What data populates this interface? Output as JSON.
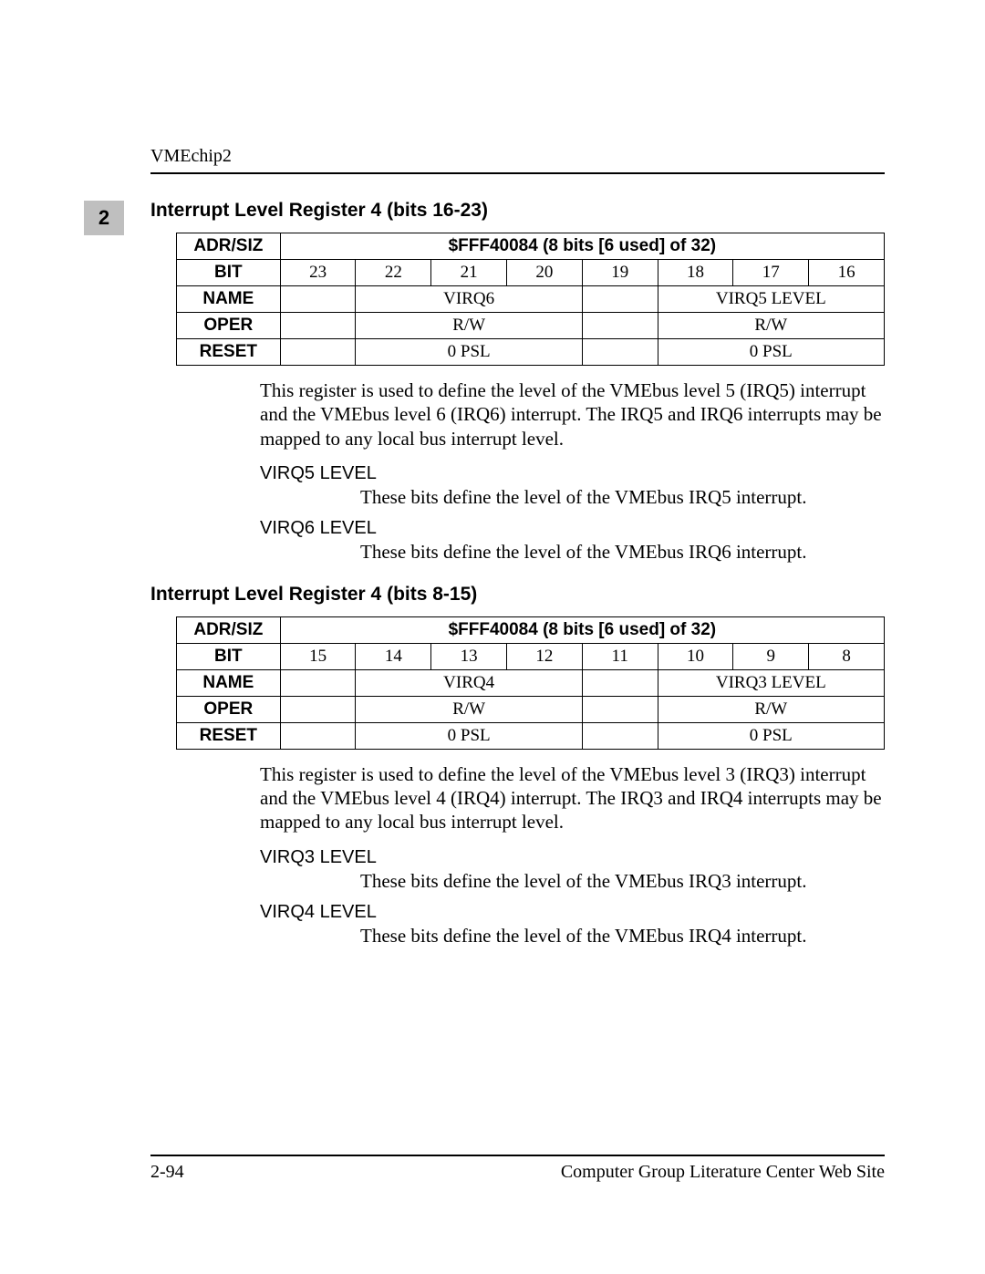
{
  "running_head": "VMEchip2",
  "chapter_tab": "2",
  "section1": {
    "title": "Interrupt Level Register 4 (bits 16-23)",
    "table": {
      "rowlabels": {
        "adrsiz": "ADR/SIZ",
        "bit": "BIT",
        "name": "NAME",
        "oper": "OPER",
        "reset": "RESET"
      },
      "adrsiz": "$FFF40084 (8 bits [6 used] of 32)",
      "bits": [
        "23",
        "22",
        "21",
        "20",
        "19",
        "18",
        "17",
        "16"
      ],
      "name_a": "VIRQ6",
      "name_b": "VIRQ5 LEVEL",
      "oper_a": "R/W",
      "oper_b": "R/W",
      "reset_a": "0 PSL",
      "reset_b": "0 PSL"
    },
    "paragraph": "This register is used to define the level of the VMEbus level 5 (IRQ5) interrupt and the VMEbus level 6 (IRQ6) interrupt. The IRQ5 and IRQ6 interrupts may be mapped to any local bus interrupt level.",
    "fields": [
      {
        "name": "VIRQ5 LEVEL",
        "desc": "These bits define the level of the VMEbus IRQ5 interrupt."
      },
      {
        "name": "VIRQ6 LEVEL",
        "desc": "These bits define the level of the VMEbus IRQ6 interrupt."
      }
    ]
  },
  "section2": {
    "title": "Interrupt Level Register 4 (bits 8-15)",
    "table": {
      "rowlabels": {
        "adrsiz": "ADR/SIZ",
        "bit": "BIT",
        "name": "NAME",
        "oper": "OPER",
        "reset": "RESET"
      },
      "adrsiz": "$FFF40084 (8 bits [6 used] of 32)",
      "bits": [
        "15",
        "14",
        "13",
        "12",
        "11",
        "10",
        "9",
        "8"
      ],
      "name_a": "VIRQ4",
      "name_b": "VIRQ3 LEVEL",
      "oper_a": "R/W",
      "oper_b": "R/W",
      "reset_a": "0 PSL",
      "reset_b": "0 PSL"
    },
    "paragraph": "This register is used to define the level of the VMEbus level 3 (IRQ3) interrupt and the VMEbus level 4 (IRQ4) interrupt. The IRQ3 and IRQ4 interrupts may be mapped to any local bus interrupt level.",
    "fields": [
      {
        "name": "VIRQ3 LEVEL",
        "desc": "These bits define the level of the VMEbus IRQ3 interrupt."
      },
      {
        "name": "VIRQ4 LEVEL",
        "desc": "These bits define the level of the VMEbus IRQ4 interrupt."
      }
    ]
  },
  "footer": {
    "left": "2-94",
    "right": "Computer Group Literature Center Web Site"
  }
}
